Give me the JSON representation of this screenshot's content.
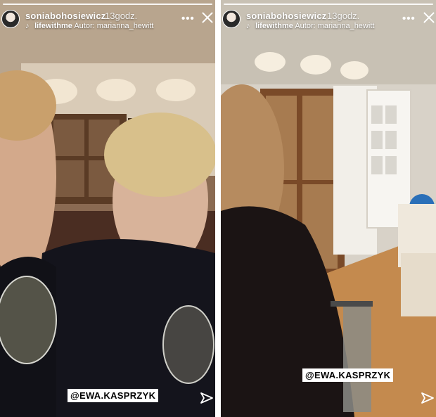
{
  "colors": {
    "text": "#ffffff",
    "mention_bg": "#ffffff",
    "mention_text": "#000000"
  },
  "stories": [
    {
      "username": "soniabohosiewicz",
      "time": "13godz.",
      "music_song": "lifewithme",
      "music_author": "Autor: marianna_hewitt",
      "mention": "@EWA.KASPRZYK",
      "icons": [
        "more-icon",
        "close-icon",
        "send-icon",
        "music-icon"
      ]
    },
    {
      "username": "soniabohosiewicz",
      "time": "13godz.",
      "music_song": "lifewithme",
      "music_author": "Autor: marianna_hewitt",
      "mention": "@EWA.KASPRZYK",
      "icons": [
        "more-icon",
        "close-icon",
        "send-icon",
        "music-icon"
      ]
    }
  ]
}
